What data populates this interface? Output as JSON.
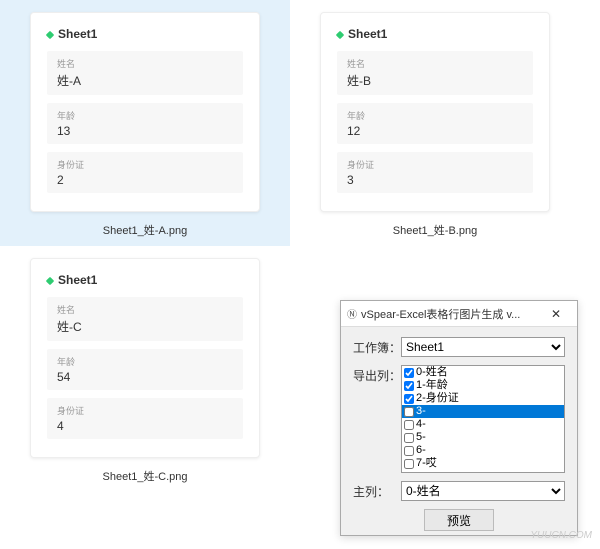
{
  "thumbnails": [
    {
      "selected": true,
      "sheet": "Sheet1",
      "filename": "Sheet1_姓-A.png",
      "fields": [
        {
          "label": "姓名",
          "value": "姓-A"
        },
        {
          "label": "年龄",
          "value": "13"
        },
        {
          "label": "身份证",
          "value": "2"
        }
      ]
    },
    {
      "selected": false,
      "sheet": "Sheet1",
      "filename": "Sheet1_姓-B.png",
      "fields": [
        {
          "label": "姓名",
          "value": "姓-B"
        },
        {
          "label": "年龄",
          "value": "12"
        },
        {
          "label": "身份证",
          "value": "3"
        }
      ]
    },
    {
      "selected": false,
      "sheet": "Sheet1",
      "filename": "Sheet1_姓-C.png",
      "fields": [
        {
          "label": "姓名",
          "value": "姓-C"
        },
        {
          "label": "年龄",
          "value": "54"
        },
        {
          "label": "身份证",
          "value": "4"
        }
      ]
    }
  ],
  "dialog": {
    "title": "vSpear-Excel表格行图片生成 v...",
    "workbook_label": "工作簿：",
    "workbook_value": "Sheet1",
    "export_label": "导出列：",
    "columns": [
      {
        "checked": true,
        "label": "0-姓名",
        "selected": false
      },
      {
        "checked": true,
        "label": "1-年龄",
        "selected": false
      },
      {
        "checked": true,
        "label": "2-身份证",
        "selected": false
      },
      {
        "checked": false,
        "label": "3-",
        "selected": true
      },
      {
        "checked": false,
        "label": "4-",
        "selected": false
      },
      {
        "checked": false,
        "label": "5-",
        "selected": false
      },
      {
        "checked": false,
        "label": "6-",
        "selected": false
      },
      {
        "checked": false,
        "label": "7-哎",
        "selected": false
      }
    ],
    "main_col_label": "主列：",
    "main_col_value": "0-姓名",
    "preview_label": "预览"
  },
  "watermark": "YUUCN.COM"
}
